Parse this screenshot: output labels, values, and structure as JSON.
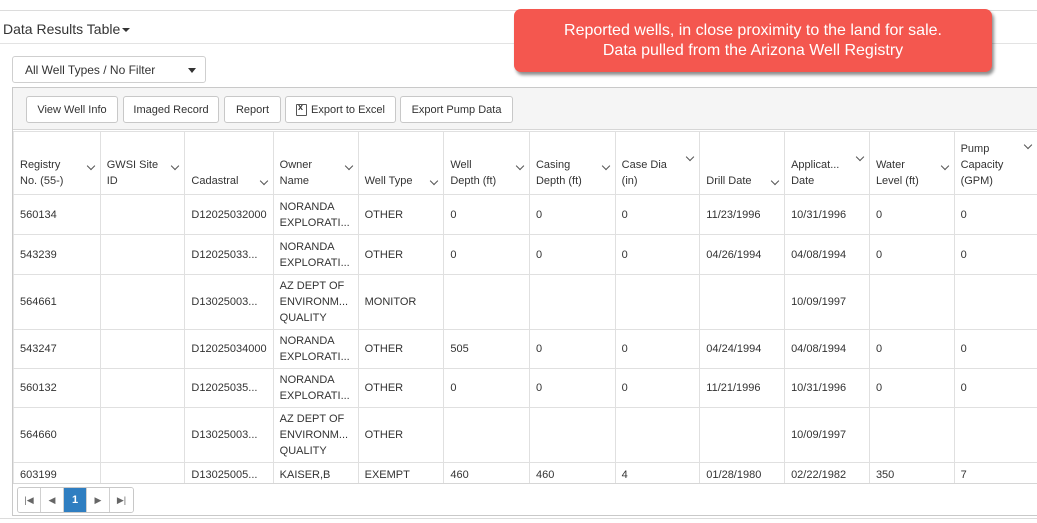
{
  "panel": {
    "title": "Data Results Table"
  },
  "callout": {
    "line1": "Reported wells, in close proximity to the land for sale.",
    "line2": "Data pulled from the Arizona Well Registry",
    "color": "#f4574f"
  },
  "filter": {
    "selected": "All Well Types / No Filter"
  },
  "toolbar": {
    "view_well_info": "View Well Info",
    "imaged_record": "Imaged Record",
    "report": "Report",
    "export_excel": "Export to Excel",
    "export_pump": "Export Pump Data"
  },
  "columns": {
    "registry": {
      "l1": "Registry",
      "l2": "No. (55-)"
    },
    "gwsi": {
      "l1": "GWSI Site",
      "l2": "ID"
    },
    "cadastral": {
      "l1": "Cadastral"
    },
    "owner": {
      "l1": "Owner",
      "l2": "Name"
    },
    "well_type": {
      "l1": "Well Type"
    },
    "well_depth": {
      "l1": "Well",
      "l2": "Depth (ft)"
    },
    "casing_depth": {
      "l1": "Casing",
      "l2": "Depth (ft)"
    },
    "case_dia": {
      "l1": "Case Dia",
      "l2": "(in)"
    },
    "drill_date": {
      "l1": "Drill Date"
    },
    "application": {
      "l1": "Applicat...",
      "l2": "Date"
    },
    "water_level": {
      "l1": "Water",
      "l2": "Level (ft)"
    },
    "pump": {
      "l1": "Pump",
      "l2": "Capacity",
      "l3": "(GPM)"
    }
  },
  "rows": [
    {
      "registry": "560134",
      "gwsi": "",
      "cadastral": "D12025032000",
      "owner_l1": "NORANDA",
      "owner_l2": "EXPLORATI...",
      "owner_l3": "",
      "well_type": "OTHER",
      "well_depth": "0",
      "casing_depth": "0",
      "case_dia": "0",
      "drill_date": "11/23/1996",
      "app_date": "10/31/1996",
      "water_level": "0",
      "pump": "0"
    },
    {
      "registry": "543239",
      "gwsi": "",
      "cadastral": "D12025033...",
      "owner_l1": "NORANDA",
      "owner_l2": "EXPLORATI...",
      "owner_l3": "",
      "well_type": "OTHER",
      "well_depth": "0",
      "casing_depth": "0",
      "case_dia": "0",
      "drill_date": "04/26/1994",
      "app_date": "04/08/1994",
      "water_level": "0",
      "pump": "0"
    },
    {
      "registry": "564661",
      "gwsi": "",
      "cadastral": "D13025003...",
      "owner_l1": "AZ DEPT OF",
      "owner_l2": "ENVIRONM...",
      "owner_l3": "QUALITY",
      "well_type": "MONITOR",
      "well_depth": "",
      "casing_depth": "",
      "case_dia": "",
      "drill_date": "",
      "app_date": "10/09/1997",
      "water_level": "",
      "pump": ""
    },
    {
      "registry": "543247",
      "gwsi": "",
      "cadastral": "D12025034000",
      "owner_l1": "NORANDA",
      "owner_l2": "EXPLORATI...",
      "owner_l3": "",
      "well_type": "OTHER",
      "well_depth": "505",
      "casing_depth": "0",
      "case_dia": "0",
      "drill_date": "04/24/1994",
      "app_date": "04/08/1994",
      "water_level": "0",
      "pump": "0"
    },
    {
      "registry": "560132",
      "gwsi": "",
      "cadastral": "D12025035...",
      "owner_l1": "NORANDA",
      "owner_l2": "EXPLORATI...",
      "owner_l3": "",
      "well_type": "OTHER",
      "well_depth": "0",
      "casing_depth": "0",
      "case_dia": "0",
      "drill_date": "11/21/1996",
      "app_date": "10/31/1996",
      "water_level": "0",
      "pump": "0"
    },
    {
      "registry": "564660",
      "gwsi": "",
      "cadastral": "D13025003...",
      "owner_l1": "AZ DEPT OF",
      "owner_l2": "ENVIRONM...",
      "owner_l3": "QUALITY",
      "well_type": "OTHER",
      "well_depth": "",
      "casing_depth": "",
      "case_dia": "",
      "drill_date": "",
      "app_date": "10/09/1997",
      "water_level": "",
      "pump": ""
    },
    {
      "registry": "603199",
      "gwsi": "",
      "cadastral": "D13025005...",
      "owner_l1": "KAISER,B",
      "owner_l2": "",
      "owner_l3": "",
      "well_type": "EXEMPT",
      "well_depth": "460",
      "casing_depth": "460",
      "case_dia": "4",
      "drill_date": "01/28/1980",
      "app_date": "02/22/1982",
      "water_level": "350",
      "pump": "7"
    }
  ],
  "pager": {
    "current": "1",
    "active_color": "#2f7ec1"
  }
}
